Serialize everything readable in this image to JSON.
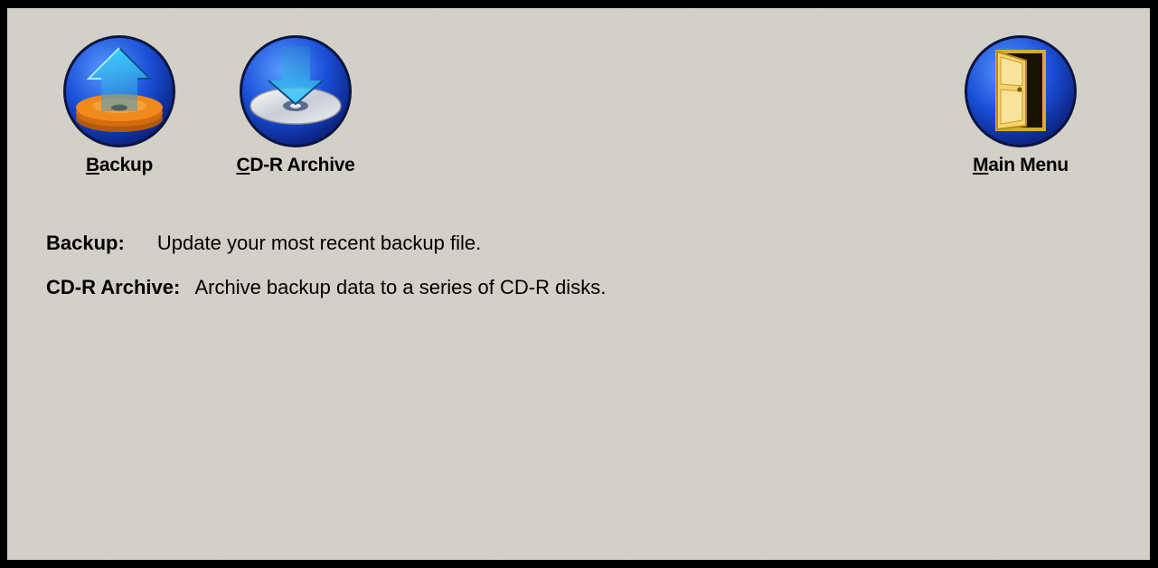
{
  "toolbar": {
    "backup": {
      "accel": "B",
      "rest": "ackup",
      "icon": "backup-disk-icon"
    },
    "archive": {
      "accel": "C",
      "rest": "D-R Archive",
      "icon": "cd-archive-icon"
    },
    "mainmenu": {
      "accel": "M",
      "rest": "ain Menu",
      "icon": "door-exit-icon"
    }
  },
  "descriptions": [
    {
      "term": "Backup:",
      "text": "Update your most recent backup file."
    },
    {
      "term": "CD-R Archive:",
      "text": "Archive backup data to a series of CD-R disks."
    }
  ],
  "colors": {
    "panel_bg": "#d4d1c8",
    "frame": "#000000",
    "icon_blue": "#1a4fd8",
    "disk_orange": "#f08a1a",
    "arrow_cyan": "#27b7e6",
    "door_yellow": "#f5d46a"
  }
}
